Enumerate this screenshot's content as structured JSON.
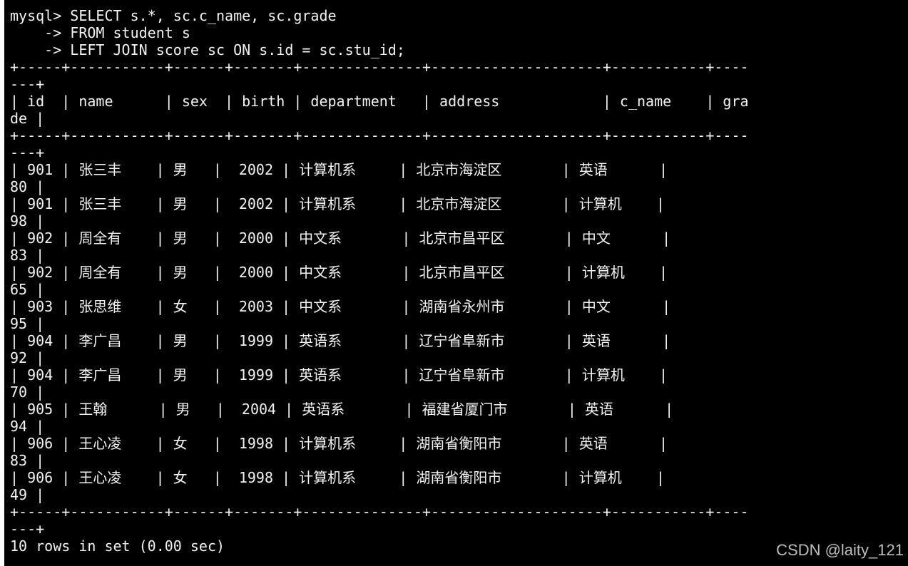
{
  "terminal": {
    "lines": [
      "mysql> SELECT s.*, sc.c_name, sc.grade",
      "    -> FROM student s",
      "    -> LEFT JOIN score sc ON s.id = sc.stu_id;",
      "+-----+-----------+------+-------+--------------+--------------------+-----------+----",
      "---+",
      "| id  | name      | sex  | birth | department   | address            | c_name    | gra",
      "de |",
      "+-----+-----------+------+-------+--------------+--------------------+-----------+----",
      "---+",
      "| 901 | 张三丰    | 男   |  2002 | 计算机系     | 北京市海淀区       | 英语      |",
      "80 |",
      "| 901 | 张三丰    | 男   |  2002 | 计算机系     | 北京市海淀区       | 计算机    |",
      "98 |",
      "| 902 | 周全有    | 男   |  2000 | 中文系       | 北京市昌平区       | 中文      |",
      "83 |",
      "| 902 | 周全有    | 男   |  2000 | 中文系       | 北京市昌平区       | 计算机    |",
      "65 |",
      "| 903 | 张思维    | 女   |  2003 | 中文系       | 湖南省永州市       | 中文      |",
      "95 |",
      "| 904 | 李广昌    | 男   |  1999 | 英语系       | 辽宁省阜新市       | 英语      |",
      "92 |",
      "| 904 | 李广昌    | 男   |  1999 | 英语系       | 辽宁省阜新市       | 计算机    |",
      "70 |",
      "| 905 | 王翰      | 男   |  2004 | 英语系       | 福建省厦门市       | 英语      |",
      "94 |",
      "| 906 | 王心凌    | 女   |  1998 | 计算机系     | 湖南省衡阳市       | 英语      |",
      "83 |",
      "| 906 | 王心凌    | 女   |  1998 | 计算机系     | 湖南省衡阳市       | 计算机    |",
      "49 |",
      "+-----+-----------+------+-------+--------------+--------------------+-----------+----",
      "---+",
      "10 rows in set (0.00 sec)"
    ]
  },
  "watermark": "CSDN @laity_121",
  "colors": {
    "background": "#000000",
    "text": "#f2f2f2",
    "watermark": "#bdbdbd",
    "left_strip": "#ffffff"
  }
}
